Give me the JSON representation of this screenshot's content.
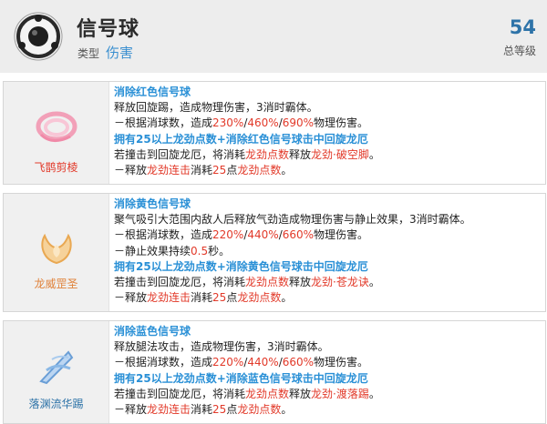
{
  "skill": {
    "title": "信号球",
    "type_label": "类型",
    "type_value": "伤害",
    "level": "54",
    "level_label": "总等级"
  },
  "cards": [
    {
      "name": "飞鹊剪棱",
      "name_color": "#e23a2a",
      "heading": "消除红色信号球",
      "line1": "释放回旋踢，造成物理伤害，3消时霸体。",
      "l2_pre": "－根据消球数，造成",
      "v1": "230%",
      "sep1": "/",
      "v2": "460%",
      "sep2": "/",
      "v3": "690%",
      "l2_post": "物理伤害。",
      "bonus": "拥有25以上龙劲点数+消除红色信号球击中回旋龙厄",
      "l4_a": "若撞击到回旋龙厄，将消耗",
      "l4_b": "龙劲点数",
      "l4_c": "释放",
      "l4_d": "龙劲·破空脚",
      "l4_e": "。",
      "l5_a": "－释放",
      "l5_b": "龙劲连击",
      "l5_c": "消耗",
      "l5_d": "25",
      "l5_e": "点",
      "l5_f": "龙劲点数",
      "l5_g": "。"
    },
    {
      "name": "龙威罡圣",
      "name_color": "#e0823a",
      "heading": "消除黄色信号球",
      "line1": "聚气吸引大范围内敌人后释放气劲造成物理伤害与静止效果，3消时霸体。",
      "l2_pre": "－根据消球数，造成",
      "v1": "220%",
      "sep1": "/",
      "v2": "440%",
      "sep2": "/",
      "v3": "660%",
      "l2_post": "物理伤害。",
      "extra_a": "－静止效果持续",
      "extra_b": "0.5",
      "extra_c": "秒。",
      "bonus": "拥有25以上龙劲点数+消除黄色信号球击中回旋龙厄",
      "l4_a": "若撞击到回旋龙厄，将消耗",
      "l4_b": "龙劲点数",
      "l4_c": "释放",
      "l4_d": "龙劲·苍龙诀",
      "l4_e": "。",
      "l5_a": "－释放",
      "l5_b": "龙劲连击",
      "l5_c": "消耗",
      "l5_d": "25",
      "l5_e": "点",
      "l5_f": "龙劲点数",
      "l5_g": "。"
    },
    {
      "name": "落渊流华踢",
      "name_color": "#2e73a8",
      "heading": "消除蓝色信号球",
      "line1": "释放腿法攻击，造成物理伤害，3消时霸体。",
      "l2_pre": "－根据消球数，造成",
      "v1": "220%",
      "sep1": "/",
      "v2": "440%",
      "sep2": "/",
      "v3": "660%",
      "l2_post": "物理伤害。",
      "bonus": "拥有25以上龙劲点数+消除蓝色信号球击中回旋龙厄",
      "l4_a": "若撞击到回旋龙厄，将消耗",
      "l4_b": "龙劲点数",
      "l4_c": "释放",
      "l4_d": "龙劲·渡落踢",
      "l4_e": "。",
      "l5_a": "－释放",
      "l5_b": "龙劲连击",
      "l5_c": "消耗",
      "l5_d": "25",
      "l5_e": "点",
      "l5_f": "龙劲点数",
      "l5_g": "。"
    }
  ],
  "icons": {
    "skill": "dark-orb-icon",
    "card1": "pink-swirl-icon",
    "card2": "golden-flame-bird-icon",
    "card3": "blue-kick-streak-icon"
  }
}
